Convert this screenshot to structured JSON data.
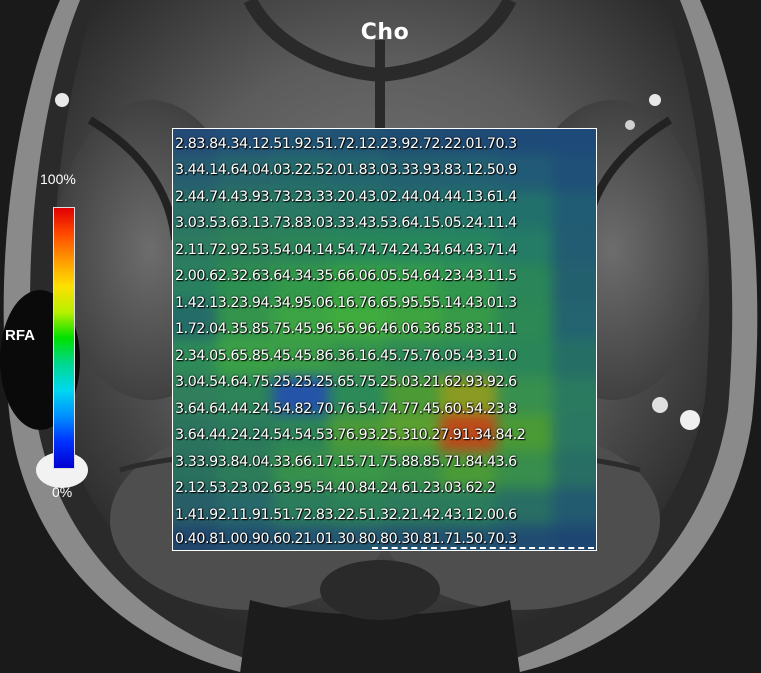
{
  "title": "Cho",
  "scale": {
    "max_label": "100%",
    "min_label": "0%",
    "name": "RFA"
  },
  "grid": {
    "rows": [
      "2.83.84.34.12.51.92.51.72.12.23.92.72.22.01.70.3",
      "3.44.14.64.04.03.22.52.01.83.03.33.93.83.12.50.9",
      "2.44.74.43.93.73.23.33.20.43.02.44.04.44.13.61.4",
      "3.03.53.63.13.73.83.03.33.43.53.64.15.05.24.11.4",
      "2.11.72.92.53.54.04.14.54.74.74.24.34.64.43.71.4",
      "2.00.62.32.63.64.34.35.66.06.05.54.64.23.43.11.5",
      "1.42.13.23.94.34.95.06.16.76.65.95.55.14.43.01.3",
      "1.72.04.35.85.75.45.96.56.96.46.06.36.85.83.11.1",
      "2.34.05.65.85.45.45.86.36.16.45.75.76.05.43.31.0",
      "3.04.54.64.75.25.25.25.65.75.25.03.21.62.93.92.6",
      "3.64.64.44.24.54.82.70.76.54.74.77.45.60.54.23.8",
      "3.64.44.24.24.54.54.53.76.93.25.310.27.91.34.84.2",
      "3.33.93.84.04.33.66.17.15.71.75.88.85.71.84.43.6",
      "2.12.53.23.02.63.95.54.40.84.24.61.23.03.62.2",
      "1.41.92.11.91.51.72.83.22.51.32.21.42.43.12.00.6",
      "0.40.81.00.90.60.21.01.30.80.80.30.81.71.50.70.3"
    ],
    "heat_colors": [
      [
        "#244a78",
        "#22507a",
        "#215578",
        "#205274",
        "#1f4d72",
        "#1f4a74",
        "#1e4a78",
        "#1e4a7a"
      ],
      [
        "#265c70",
        "#27666c",
        "#256a6a",
        "#24666e",
        "#236070",
        "#226072",
        "#215a76",
        "#1f5078"
      ],
      [
        "#2a7066",
        "#2a7862",
        "#287864",
        "#267466",
        "#24706a",
        "#23746a",
        "#22706c",
        "#205c74"
      ],
      [
        "#2c7a60",
        "#2c8058",
        "#2a8458",
        "#28885a",
        "#27885c",
        "#268660",
        "#247c66",
        "#225c72"
      ],
      [
        "#288060",
        "#2c8e50",
        "#32984a",
        "#36a244",
        "#34a048",
        "#30964e",
        "#2a8658",
        "#23606e"
      ],
      [
        "#246c68",
        "#34944c",
        "#3ca444",
        "#40ac3e",
        "#3ea440",
        "#369a48",
        "#2c8854",
        "#236470"
      ],
      [
        "#2e8a58",
        "#3aa046",
        "#3a9c48",
        "#34924e",
        "#2e8a56",
        "#2c8a58",
        "#2a8658",
        "#256e66"
      ],
      [
        "#307e5c",
        "#2c8458",
        "#2454a8",
        "#2c8a58",
        "#4c9a36",
        "#8a9a22",
        "#38904e",
        "#2a7a60"
      ],
      [
        "#2c745e",
        "#2a7a5c",
        "#2c8456",
        "#4a9a38",
        "#5aa030",
        "#bc4a1a",
        "#4a9a36",
        "#2a7862"
      ],
      [
        "#2a705e",
        "#2c7c5a",
        "#36904c",
        "#3a9648",
        "#389048",
        "#4a9a38",
        "#388e4c",
        "#286e64"
      ],
      [
        "#275e68",
        "#27686a",
        "#2a7c5c",
        "#2c8058",
        "#2c7a5c",
        "#2a7c5c",
        "#286e64",
        "#225a70"
      ],
      [
        "#20466e",
        "#214e70",
        "#235472",
        "#245872",
        "#235270",
        "#225270",
        "#204c72",
        "#1e4672"
      ]
    ]
  }
}
